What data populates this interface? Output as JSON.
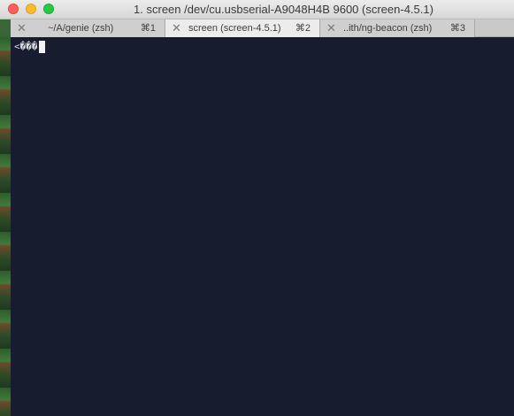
{
  "window": {
    "title": "1. screen /dev/cu.usbserial-A9048H4B 9600 (screen-4.5.1)"
  },
  "tabs": [
    {
      "close_glyph": "✕",
      "label": "~/A/genie (zsh)",
      "shortcut": "⌘1",
      "active": false
    },
    {
      "close_glyph": "✕",
      "label": "screen (screen-4.5.1)",
      "shortcut": "⌘2",
      "active": true
    },
    {
      "close_glyph": "✕",
      "label": "..ith/ng-beacon (zsh)",
      "shortcut": "⌘3",
      "active": false
    }
  ],
  "terminal": {
    "output": "<���",
    "background": "#171c2e",
    "foreground": "#d7d9e0"
  },
  "colors": {
    "close": "#fc5f57",
    "minimize": "#fdbc2e",
    "zoom": "#28c840"
  },
  "icons": {
    "close": "close-icon",
    "minimize": "minimize-icon",
    "zoom": "zoom-icon",
    "tab_close": "tab-close-icon"
  }
}
